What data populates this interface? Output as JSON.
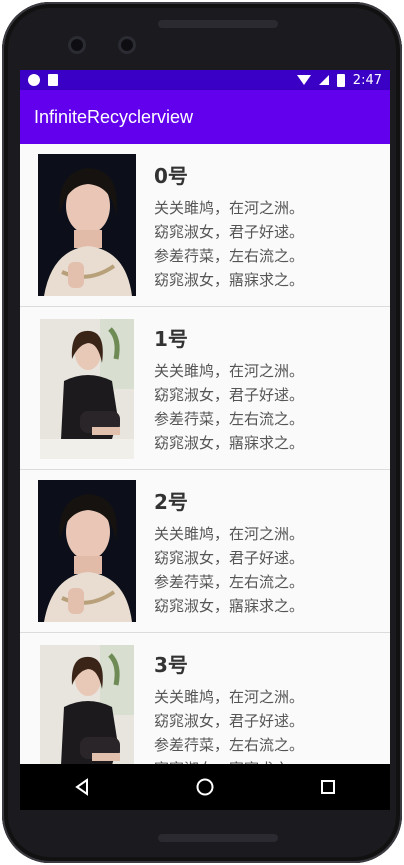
{
  "status_bar": {
    "time": "2:47",
    "icons": [
      "circle-icon",
      "sd-card-icon",
      "wifi-icon",
      "signal-icon",
      "battery-icon"
    ]
  },
  "app_bar": {
    "title": "InfiniteRecyclerview"
  },
  "list": {
    "items": [
      {
        "title": "0号",
        "lines": [
          "关关雎鸠，在河之洲。",
          "窈窕淑女，君子好逑。",
          "参差荇菜，左右流之。",
          "窈窕淑女，寤寐求之。"
        ],
        "image": "woman-portrait-dark-background"
      },
      {
        "title": "1号",
        "lines": [
          "关关雎鸠，在河之洲。",
          "窈窕淑女，君子好逑。",
          "参差荇菜，左右流之。",
          "窈窕淑女，寤寐求之。"
        ],
        "image": "woman-seated-black-suit"
      },
      {
        "title": "2号",
        "lines": [
          "关关雎鸠，在河之洲。",
          "窈窕淑女，君子好逑。",
          "参差荇菜，左右流之。",
          "窈窕淑女，寤寐求之。"
        ],
        "image": "woman-portrait-dark-background"
      },
      {
        "title": "3号",
        "lines": [
          "关关雎鸠，在河之洲。",
          "窈窕淑女，君子好逑。",
          "参差荇菜，左右流之。",
          "窈窕淑女，寤寐求之。"
        ],
        "image": "woman-seated-black-suit"
      }
    ]
  },
  "nav_bar": {
    "buttons": [
      "back-icon",
      "home-icon",
      "recents-icon"
    ]
  },
  "colors": {
    "status_bar": "#3a00c5",
    "app_bar": "#6200ee"
  }
}
